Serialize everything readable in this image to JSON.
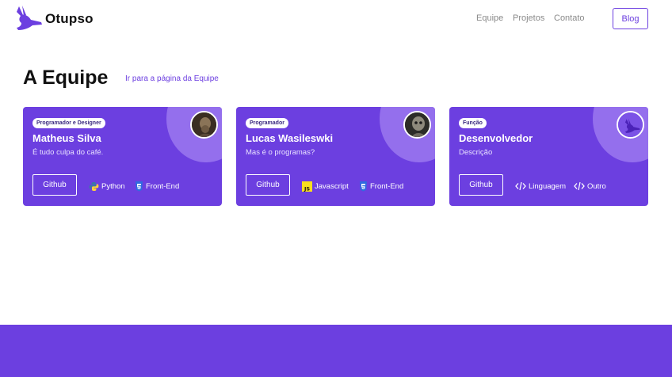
{
  "brand": {
    "name": "Otupso",
    "logo_icon": "rabbit-logo-icon",
    "accent": "#6c3fe0"
  },
  "nav": {
    "items": [
      "Equipe",
      "Projetos",
      "Contato"
    ],
    "blog_label": "Blog"
  },
  "section": {
    "title": "A Equipe",
    "link_label": "Ir para a página da Equipe"
  },
  "cards": [
    {
      "role": "Programador e Designer",
      "name": "Matheus Silva",
      "description": "É tudo culpa do café.",
      "button_label": "Github",
      "avatar_icon": "avatar-photo",
      "tags": [
        {
          "label": "Python",
          "icon": "python-icon"
        },
        {
          "label": "Front-End",
          "icon": "css3-icon"
        }
      ]
    },
    {
      "role": "Programador",
      "name": "Lucas Wasileswki",
      "description": "Mas é o programas?",
      "button_label": "Github",
      "avatar_icon": "avatar-photo",
      "tags": [
        {
          "label": "Javascript",
          "icon": "javascript-icon"
        },
        {
          "label": "Front-End",
          "icon": "css3-icon"
        }
      ]
    },
    {
      "role": "Função",
      "name": "Desenvolvedor",
      "description": "Descrição",
      "button_label": "Github",
      "avatar_icon": "rabbit-logo-icon",
      "tags": [
        {
          "label": "Linguagem",
          "icon": "code-icon"
        },
        {
          "label": "Outro",
          "icon": "code-icon"
        }
      ]
    }
  ]
}
